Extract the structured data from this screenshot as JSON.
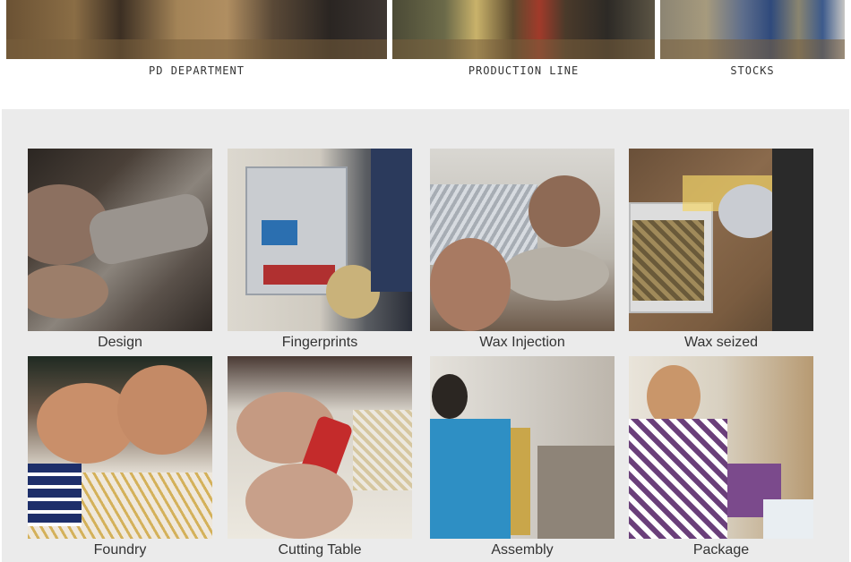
{
  "top_sections": [
    {
      "label": "PD DEPARTMENT"
    },
    {
      "label": "PRODUCTION LINE"
    },
    {
      "label": "STOCKS"
    }
  ],
  "process_steps": [
    {
      "caption": "Design"
    },
    {
      "caption": "Fingerprints"
    },
    {
      "caption": "Wax Injection"
    },
    {
      "caption": "Wax seized"
    },
    {
      "caption": "Foundry"
    },
    {
      "caption": "Cutting Table"
    },
    {
      "caption": "Assembly"
    },
    {
      "caption": "Package"
    }
  ]
}
